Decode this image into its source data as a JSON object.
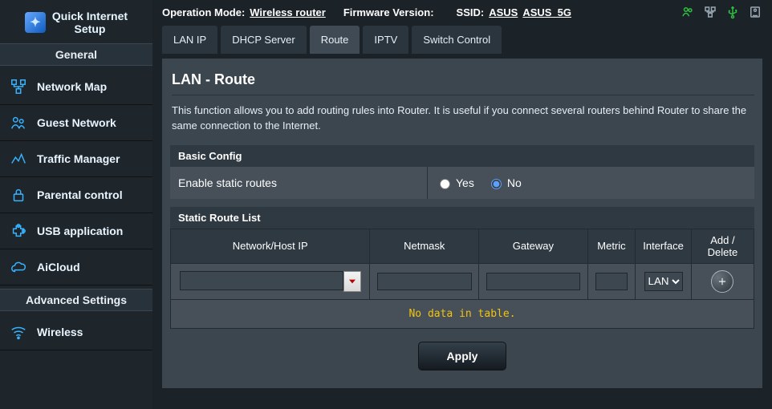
{
  "quick_setup": "Quick Internet\nSetup",
  "sections": {
    "general": "General",
    "advanced": "Advanced Settings"
  },
  "nav": {
    "general": [
      {
        "label": "Network Map"
      },
      {
        "label": "Guest Network"
      },
      {
        "label": "Traffic Manager"
      },
      {
        "label": "Parental control"
      },
      {
        "label": "USB application"
      },
      {
        "label": "AiCloud"
      }
    ],
    "advanced": [
      {
        "label": "Wireless"
      }
    ]
  },
  "topbar": {
    "op_mode_label": "Operation Mode:",
    "op_mode": "Wireless  router",
    "fw_label": "Firmware Version:",
    "fw": "",
    "ssid_label": "SSID:",
    "ssid1": "ASUS",
    "ssid2": "ASUS_5G"
  },
  "tabs": [
    "LAN IP",
    "DHCP Server",
    "Route",
    "IPTV",
    "Switch Control"
  ],
  "active_tab": 2,
  "page": {
    "title": "LAN - Route",
    "desc": "This function allows you to add routing rules into Router. It is useful if you connect several routers behind Router to share the same connection to the Internet.",
    "basic": {
      "header": "Basic Config",
      "enable_label": "Enable static routes",
      "yes": "Yes",
      "no": "No",
      "value": "No"
    },
    "list": {
      "header": "Static Route List",
      "cols": [
        "Network/Host IP",
        "Netmask",
        "Gateway",
        "Metric",
        "Interface",
        "Add / Delete"
      ],
      "iface_options": [
        "LAN"
      ],
      "iface_selected": "LAN",
      "empty": "No data in table."
    },
    "apply": "Apply"
  }
}
